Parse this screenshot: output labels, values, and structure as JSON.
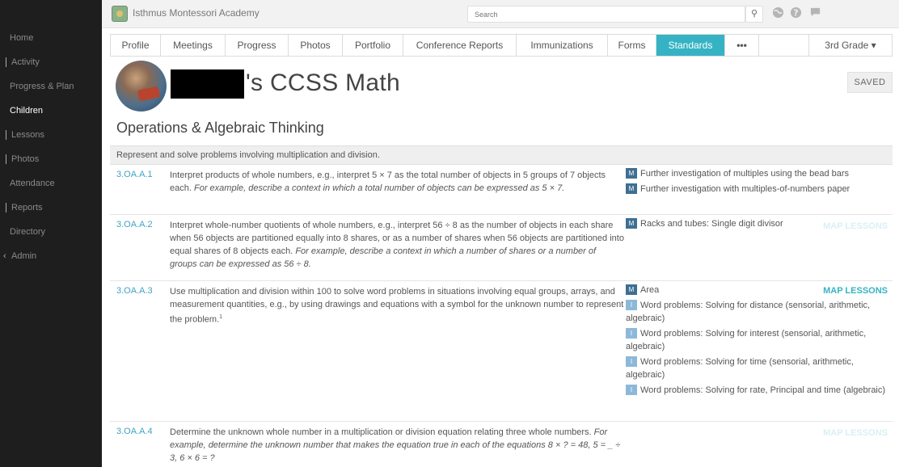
{
  "sidebar": {
    "items": [
      {
        "label": "Home"
      },
      {
        "label": "Activity"
      },
      {
        "label": "Progress & Plan"
      },
      {
        "label": "Children"
      },
      {
        "label": "Lessons"
      },
      {
        "label": "Photos"
      },
      {
        "label": "Attendance"
      },
      {
        "label": "Reports"
      },
      {
        "label": "Directory"
      },
      {
        "label": "Admin"
      }
    ],
    "active": "Children"
  },
  "topbar": {
    "school_name": "Isthmus Montessori Academy",
    "search_placeholder": "Search",
    "search_icon": "search-icon",
    "icons": [
      "globe-icon",
      "help-icon",
      "chat-icon"
    ]
  },
  "tabs": [
    {
      "label": "Profile"
    },
    {
      "label": "Meetings"
    },
    {
      "label": "Progress"
    },
    {
      "label": "Photos"
    },
    {
      "label": "Portfolio"
    },
    {
      "label": "Conference Reports"
    },
    {
      "label": "Immunizations"
    },
    {
      "label": "Forms"
    },
    {
      "label": "Standards"
    },
    {
      "label": "•••"
    },
    {
      "label": ""
    },
    {
      "label": "3rd Grade ▾"
    }
  ],
  "active_tab": "Standards",
  "header": {
    "title": "'s CCSS Math",
    "saved_label": "SAVED"
  },
  "section_title": "Operations & Algebraic Thinking",
  "cluster": "Represent and solve problems involving multiplication and division.",
  "map_lessons_label": "MAP LESSONS",
  "standards": [
    {
      "code": "3.OA.A.1",
      "text": "Interpret products of whole numbers, e.g., interpret 5 × 7 as the total number of objects in 5 groups of 7 objects each.",
      "example": "For example, describe a context in which a total number of objects can be expressed as 5 × 7.",
      "lessons": [
        {
          "type": "M",
          "label": "Further investigation of multiples using the bead bars"
        },
        {
          "type": "M",
          "label": "Further investigation with multiples-of-numbers paper"
        }
      ]
    },
    {
      "code": "3.OA.A.2",
      "text": "Interpret whole-number quotients of whole numbers, e.g., interpret 56 ÷ 8 as the number of objects in each share when 56 objects are partitioned equally into 8 shares, or as a number of shares when 56 objects are partitioned into equal shares of 8 objects each.",
      "example": "For example, describe a context in which a number of shares or a number of groups can be expressed as 56 ÷ 8.",
      "lessons": [
        {
          "type": "M",
          "label": "Racks and tubes: Single digit divisor"
        }
      ]
    },
    {
      "code": "3.OA.A.3",
      "text": "Use multiplication and division within 100 to solve word problems in situations involving equal groups, arrays, and measurement quantities, e.g., by using drawings and equations with a symbol for the unknown number to represent the problem.",
      "footnote": "1",
      "lessons": [
        {
          "type": "M",
          "label": "Area"
        },
        {
          "type": "I",
          "label": "Word problems: Solving for distance (sensorial, arithmetic, algebraic)"
        },
        {
          "type": "I",
          "label": "Word problems: Solving for interest (sensorial, arithmetic, algebraic)"
        },
        {
          "type": "I",
          "label": "Word problems: Solving for time (sensorial, arithmetic, algebraic)"
        },
        {
          "type": "I",
          "label": "Word problems: Solving for rate, Principal and time (algebraic)"
        }
      ]
    },
    {
      "code": "3.OA.A.4",
      "text": "Determine the unknown whole number in a multiplication or division equation relating three whole numbers.",
      "example": "For example, determine the unknown number that makes the equation true in each of the equations 8 × ? = 48, 5 = _ ÷ 3, 6 × 6 = ?",
      "lessons": []
    }
  ]
}
